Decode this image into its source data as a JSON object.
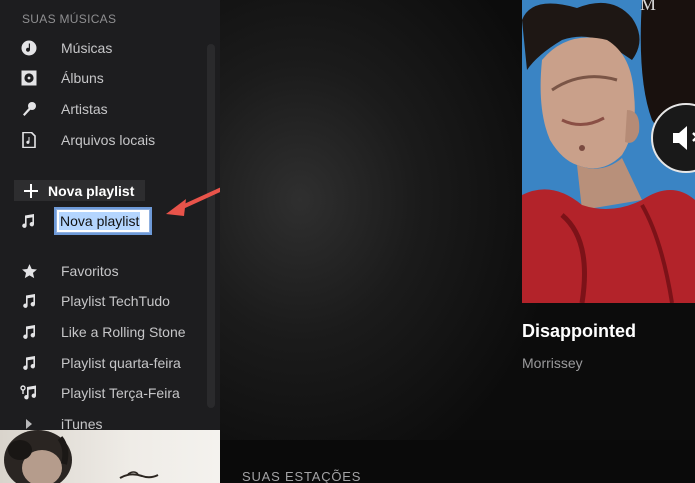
{
  "sidebar": {
    "section_title": "SUAS MÚSICAS",
    "library": [
      {
        "label": "Músicas",
        "icon": "music-disc-icon"
      },
      {
        "label": "Álbuns",
        "icon": "album-icon"
      },
      {
        "label": "Artistas",
        "icon": "microphone-icon"
      },
      {
        "label": "Arquivos locais",
        "icon": "local-file-icon"
      }
    ],
    "new_playlist_button": "Nova playlist",
    "rename_value": "Nova playlist",
    "playlists": [
      {
        "label": "Favoritos",
        "icon": "star-icon"
      },
      {
        "label": "Playlist TechTudo",
        "icon": "music-note-icon"
      },
      {
        "label": "Like a Rolling Stone",
        "icon": "music-note-icon"
      },
      {
        "label": "Playlist quarta-feira",
        "icon": "music-note-icon"
      },
      {
        "label": "Playlist Terça-Feira",
        "icon": "collab-playlist-icon"
      },
      {
        "label": "iTunes",
        "icon": "triangle-right-icon"
      }
    ]
  },
  "now_playing": {
    "title": "Disappointed",
    "artist": "Morrissey"
  },
  "main": {
    "stations_title": "SUAS ESTAÇÕES"
  },
  "colors": {
    "sidebar_bg": "#1d1d1f",
    "annotation_arrow": "#e8534a",
    "selection": "#b4d5fe"
  }
}
